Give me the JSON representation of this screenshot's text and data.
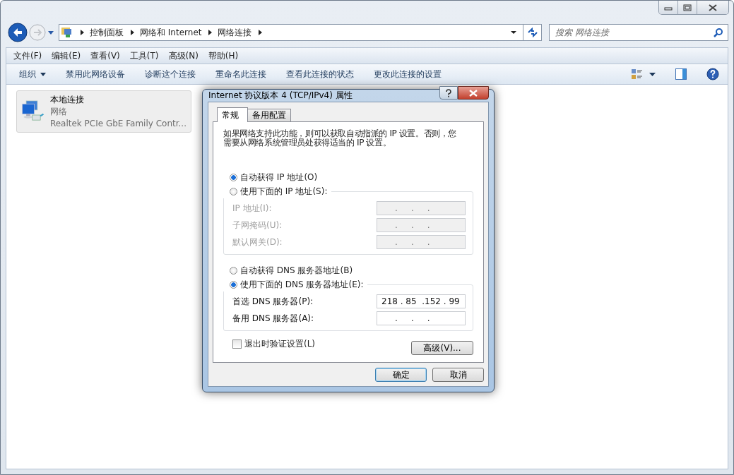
{
  "address_bar": {
    "breadcrumbs": [
      "控制面板",
      "网络和 Internet",
      "网络连接"
    ]
  },
  "search": {
    "placeholder": "搜索 网络连接"
  },
  "menu": [
    "文件(F)",
    "编辑(E)",
    "查看(V)",
    "工具(T)",
    "高级(N)",
    "帮助(H)"
  ],
  "toolbar": [
    {
      "label": "组织",
      "kind": "menu"
    },
    {
      "label": "禁用此网络设备",
      "kind": "action"
    },
    {
      "label": "诊断这个连接",
      "kind": "action"
    },
    {
      "label": "重命名此连接",
      "kind": "action"
    },
    {
      "label": "查看此连接的状态",
      "kind": "action"
    },
    {
      "label": "更改此连接的设置",
      "kind": "action"
    }
  ],
  "connections": [
    {
      "name": "本地连接",
      "status": "网络",
      "device": "Realtek PCIe GbE Family Contr...",
      "selected": true
    }
  ],
  "dialog": {
    "title": "Internet 协议版本 4 (TCP/IPv4) 属性",
    "tabs": [
      {
        "label": "常规",
        "selected": true
      },
      {
        "label": "备用配置",
        "selected": false
      }
    ],
    "description": "如果网络支持此功能，则可以获取自动指派的 IP 设置。否则，您需要从网络系统管理员处获得适当的 IP 设置。",
    "ip_mode": [
      {
        "label": "自动获得 IP 地址(O)",
        "selected": true
      },
      {
        "label": "使用下面的 IP 地址(S):",
        "selected": false
      }
    ],
    "ip_fields": {
      "disabled": true,
      "rows": [
        {
          "label": "IP 地址(I):",
          "value": "     .     .     ."
        },
        {
          "label": "子网掩码(U):",
          "value": "     .     .     ."
        },
        {
          "label": "默认网关(D):",
          "value": "     .     .     ."
        }
      ]
    },
    "dns_mode": [
      {
        "label": "自动获得 DNS 服务器地址(B)",
        "selected": false
      },
      {
        "label": "使用下面的 DNS 服务器地址(E):",
        "selected": true
      }
    ],
    "dns_fields": {
      "disabled": false,
      "rows": [
        {
          "label": "首选 DNS 服务器(P):",
          "value": "218 . 85  .152 . 99"
        },
        {
          "label": "备用 DNS 服务器(A):",
          "value": "     .     .     ."
        }
      ]
    },
    "validate": {
      "label": "退出时验证设置(L)",
      "checked": false
    },
    "advanced_button": "高级(V)...",
    "buttons": [
      {
        "label": "确定",
        "default": true
      },
      {
        "label": "取消",
        "default": false
      }
    ]
  }
}
